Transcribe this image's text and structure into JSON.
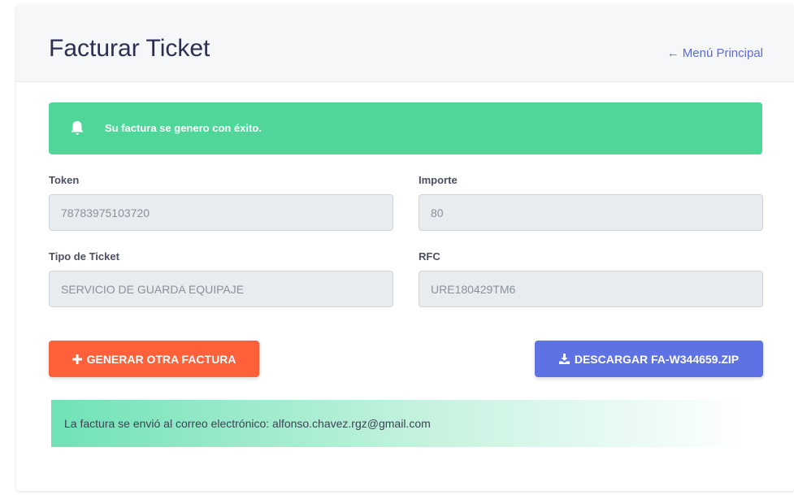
{
  "header": {
    "title": "Facturar Ticket",
    "back_link": "Menú Principal",
    "back_icon": "arrow-left-icon"
  },
  "alert": {
    "icon": "bell-icon",
    "message": "Su factura se genero con éxito.",
    "color": "#50d699"
  },
  "form": {
    "token_label": "Token",
    "token_value": "78783975103720",
    "importe_label": "Importe",
    "importe_value": "80",
    "tipo_label": "Tipo de Ticket",
    "tipo_value": "SERVICIO DE GUARDA EQUIPAJE",
    "rfc_label": "RFC",
    "rfc_value": "URE180429TM6"
  },
  "actions": {
    "generate_label": "GENERAR OTRA FACTURA",
    "generate_icon": "plus-icon",
    "generate_color": "#fe6039",
    "download_label": "DESCARGAR FA-W344659.ZIP",
    "download_icon": "download-icon",
    "download_color": "#5e72e4"
  },
  "info": {
    "message": "La factura se envió al correo electrónico: alfonso.chavez.rgz@gmail.com"
  }
}
